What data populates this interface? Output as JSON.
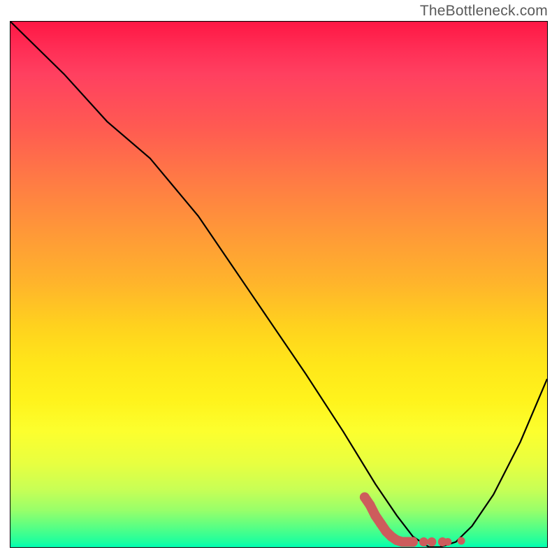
{
  "watermark": "TheBottleneck.com",
  "chart_data": {
    "type": "line",
    "title": "",
    "xlabel": "",
    "ylabel": "",
    "xlim": [
      0,
      100
    ],
    "ylim": [
      0,
      100
    ],
    "grid": false,
    "legend": false,
    "series": [
      {
        "name": "bottleneck-curve",
        "color": "#000000",
        "x": [
          0,
          10,
          18,
          26,
          35,
          45,
          55,
          62,
          68,
          72,
          75,
          78,
          80,
          83,
          86,
          90,
          95,
          100
        ],
        "y": [
          100,
          90,
          81,
          74,
          63,
          48,
          33,
          22,
          12,
          6,
          2,
          0,
          0,
          1,
          4,
          10,
          20,
          32
        ]
      },
      {
        "name": "recommended-range-markers",
        "color": "#cd5c5c",
        "points": [
          {
            "x": 66,
            "y": 9.5
          },
          {
            "x": 67,
            "y": 8
          },
          {
            "x": 68,
            "y": 6
          },
          {
            "x": 69,
            "y": 4.5
          },
          {
            "x": 70,
            "y": 3
          },
          {
            "x": 71,
            "y": 2
          },
          {
            "x": 72,
            "y": 1.3
          },
          {
            "x": 73,
            "y": 1
          },
          {
            "x": 75,
            "y": 1
          },
          {
            "x": 77,
            "y": 1
          },
          {
            "x": 78.5,
            "y": 1
          },
          {
            "x": 80.5,
            "y": 1
          },
          {
            "x": 81.5,
            "y": 1
          },
          {
            "x": 84,
            "y": 1.2
          }
        ]
      }
    ],
    "background_gradient": {
      "top": "#ff1744",
      "middle": "#ffd21e",
      "bottom": "#00ffb3",
      "meaning": "red = high bottleneck, green = low bottleneck"
    }
  }
}
